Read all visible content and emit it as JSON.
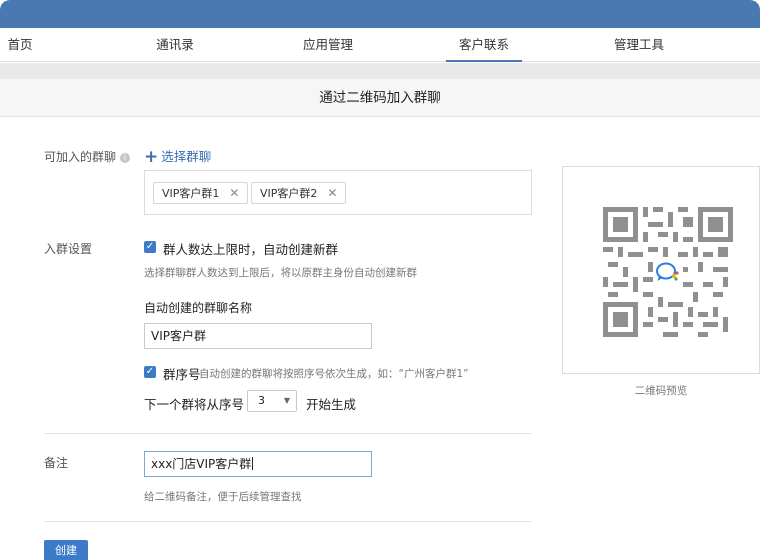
{
  "nav": {
    "items": [
      {
        "label": "首页"
      },
      {
        "label": "通讯录"
      },
      {
        "label": "应用管理"
      },
      {
        "label": "客户联系",
        "active": true
      },
      {
        "label": "管理工具"
      }
    ]
  },
  "page_title": "通过二维码加入群聊",
  "joinable_groups": {
    "label": "可加入的群聊",
    "info_icon": "i",
    "select_link": "选择群聊",
    "chips": [
      {
        "label": "VIP客户群1",
        "remove": "✕"
      },
      {
        "label": "VIP客户群2",
        "remove": "✕"
      }
    ]
  },
  "join_settings": {
    "label": "入群设置",
    "auto_create_checkbox": "群人数达上限时，自动创建新群",
    "auto_create_hint": "选择群聊群人数达到上限后，将以原群主身份自动创建新群",
    "auto_name_label": "自动创建的群聊名称",
    "auto_name_value": "VIP客户群",
    "serial_checkbox": "群序号",
    "serial_hint": "自动创建的群聊将按照序号依次生成，如：“广州客户群1”",
    "next_serial_prefix": "下一个群将从序号",
    "next_serial_value": "3",
    "next_serial_suffix": "开始生成"
  },
  "remark": {
    "label": "备注",
    "value": "xxx门店VIP客户群",
    "hint": "给二维码备注，便于后续管理查找"
  },
  "create_button": "创建",
  "qr": {
    "caption": "二维码预览",
    "logo_icon": "wecom-chat-icon"
  },
  "colors": {
    "topbar": "#4a78b0",
    "accent": "#3d7bc9",
    "link": "#3b6fb0"
  }
}
